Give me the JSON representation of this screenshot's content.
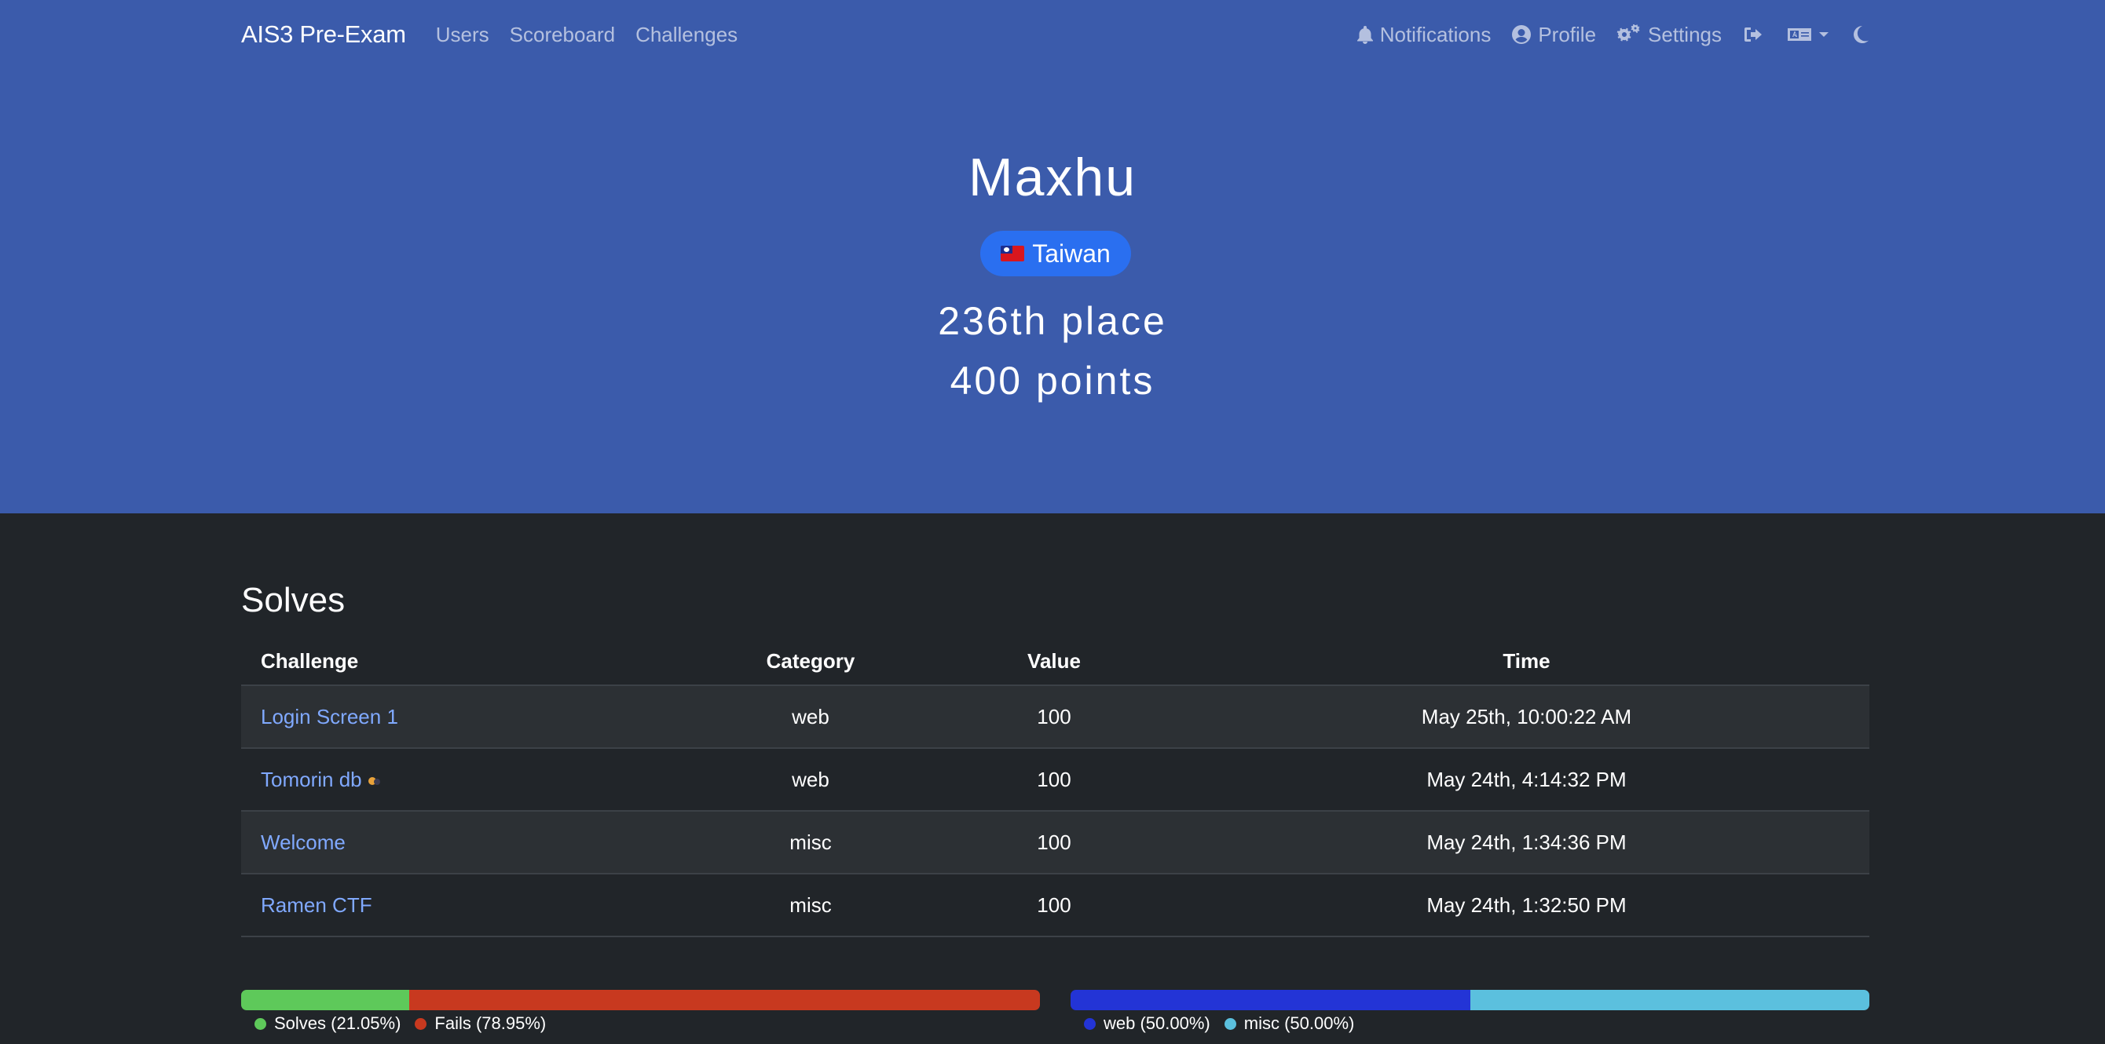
{
  "nav": {
    "brand": "AIS3 Pre-Exam",
    "links": [
      "Users",
      "Scoreboard",
      "Challenges"
    ],
    "notifications": "Notifications",
    "profile": "Profile",
    "settings": "Settings"
  },
  "user": {
    "name": "Maxhu",
    "country": "Taiwan",
    "place": "236th place",
    "points": "400 points"
  },
  "solves": {
    "title": "Solves",
    "headers": [
      "Challenge",
      "Category",
      "Value",
      "Time"
    ],
    "rows": [
      {
        "challenge": "Login Screen 1",
        "category": "web",
        "value": "100",
        "time": "May 25th, 10:00:22 AM"
      },
      {
        "challenge": "Tomorin db",
        "category": "web",
        "value": "100",
        "time": "May 24th, 4:14:32 PM"
      },
      {
        "challenge": "Welcome",
        "category": "misc",
        "value": "100",
        "time": "May 24th, 1:34:36 PM"
      },
      {
        "challenge": "Ramen CTF",
        "category": "misc",
        "value": "100",
        "time": "May 24th, 1:32:50 PM"
      }
    ]
  },
  "chart_data": [
    {
      "type": "bar",
      "categories": [
        "Solves",
        "Fails"
      ],
      "values": [
        21.05,
        78.95
      ],
      "legend": [
        "Solves (21.05%)",
        "Fails (78.95%)"
      ],
      "colors": [
        "#5ec95a",
        "#c8391f"
      ]
    },
    {
      "type": "bar",
      "categories": [
        "web",
        "misc"
      ],
      "values": [
        50.0,
        50.0
      ],
      "legend": [
        "web (50.00%)",
        "misc (50.00%)"
      ],
      "colors": [
        "#2334d6",
        "#5bc0de"
      ]
    }
  ],
  "colors": {
    "jumbotron": "#3b5bab",
    "background": "#212529",
    "link": "#80a9ff",
    "badge": "#2a6ff0"
  }
}
